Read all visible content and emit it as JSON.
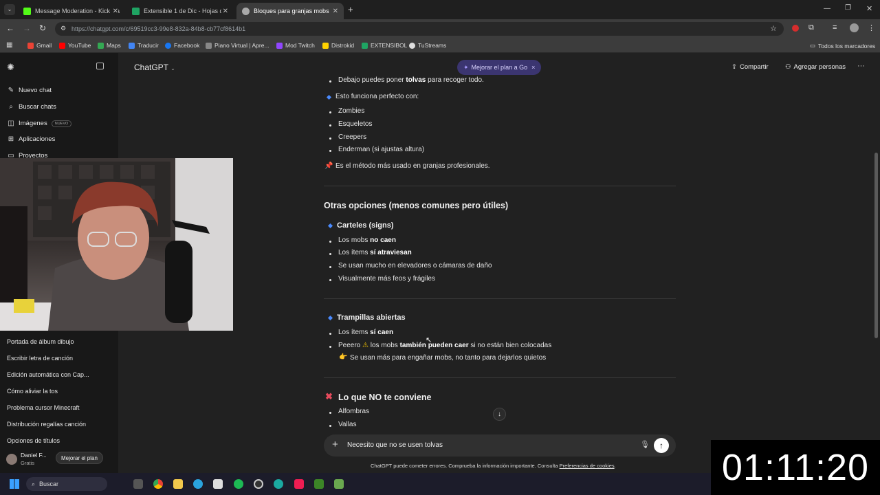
{
  "tabs": [
    {
      "label": "Message Moderation - Kick Da",
      "color": "#53fc18"
    },
    {
      "label": "Extensible 1 de Dic - Hojas de",
      "color": "#1fa463"
    },
    {
      "label": "Bloques para granjas mobs",
      "color": "#aaaaaa"
    }
  ],
  "url": "https://chatgpt.com/c/69519cc3-99e8-832a-84b8-cb77cf8614b1",
  "bookmarks": [
    {
      "label": "Gmail",
      "color": "#ea4335"
    },
    {
      "label": "YouTube",
      "color": "#ff0000"
    },
    {
      "label": "Maps",
      "color": "#34a853"
    },
    {
      "label": "Traducir",
      "color": "#4285f4"
    },
    {
      "label": "Facebook",
      "color": "#1877f2"
    },
    {
      "label": "Piano Virtual | Apre...",
      "color": "#888888"
    },
    {
      "label": "Mod Twitch",
      "color": "#9146ff"
    },
    {
      "label": "Distrokid",
      "color": "#ffd200"
    },
    {
      "label": "EXTENSIBOL",
      "color": "#1fa463"
    },
    {
      "label": "TuStreams",
      "color": "#dddddd"
    }
  ],
  "all_bookmarks": "Todos los marcadores",
  "sidebar": {
    "new_chat": "Nuevo chat",
    "search": "Buscar chats",
    "images": "Imágenes",
    "images_badge": "NUEVO",
    "apps": "Aplicaciones",
    "projects": "Proyectos",
    "history": [
      "Portada de álbum dibujo",
      "Escribir letra de canción",
      "Edición automática con Cap...",
      "Cómo aliviar la tos",
      "Problema cursor Minecraft",
      "Distribución regalías canción",
      "Opciones de títulos"
    ],
    "user_name": "Daniel F...",
    "user_plan": "Gratis",
    "upgrade": "Mejorar el plan"
  },
  "header": {
    "model": "ChatGPT",
    "upgrade_pill": "Mejorar el plan a Go",
    "share": "Compartir",
    "add_people": "Agregar personas"
  },
  "content": {
    "l1a": "Debajo puedes poner ",
    "l1b": "tolvas",
    "l1c": " para recoger todo.",
    "l2": "Esto funciona perfecto con:",
    "list1": [
      "Zombies",
      "Esqueletos",
      "Creepers",
      "Enderman (si ajustas altura)"
    ],
    "pin_note": "Es el método más usado en granjas profesionales.",
    "h_other": "Otras opciones (menos comunes pero útiles)",
    "signs_title": "Carteles (signs)",
    "s1a": "Los mobs ",
    "s1b": "no caen",
    "s2a": "Los ítems ",
    "s2b": "sí atraviesan",
    "s3": "Se usan mucho en elevadores o cámaras de daño",
    "s4": "Visualmente más feos y frágiles",
    "trap_title": "Trampillas abiertas",
    "t1a": "Los ítems ",
    "t1b": "sí caen",
    "t2a": "Peeero ",
    "t2b": " los mobs ",
    "t2c": "también pueden caer",
    "t2d": " si no están bien colocadas",
    "t3": "Se usan más para engañar mobs, no tanto para dejarlos quietos",
    "h_no": "Lo que NO te conviene",
    "list_no": [
      "Alfombras",
      "Vallas"
    ]
  },
  "composer": {
    "text": "Necesito que no se usen tolvas"
  },
  "footer": {
    "text": "ChatGPT puede cometer errores. Comprueba la información importante. Consulta ",
    "link": "Preferencias de cookies",
    "end": "."
  },
  "taskbar": {
    "search": "Buscar"
  },
  "timer": "01:11:20"
}
